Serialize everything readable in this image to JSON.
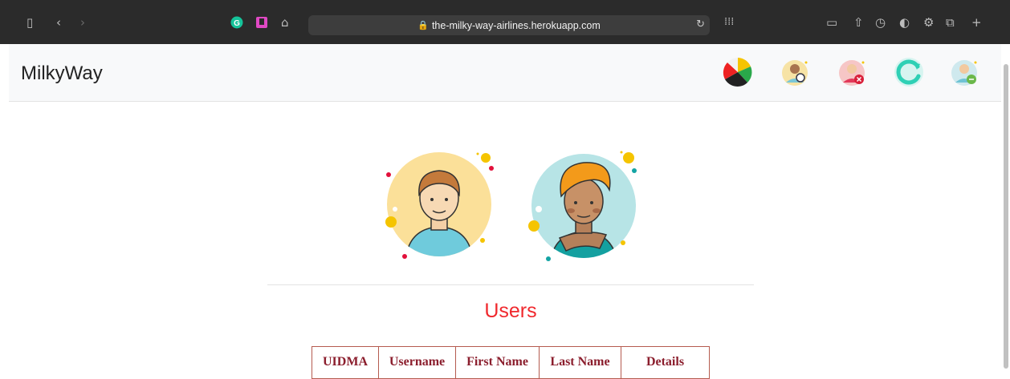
{
  "browser": {
    "url": "the-milky-way-airlines.herokuapp.com"
  },
  "navbar": {
    "brand": "MilkyWay"
  },
  "page": {
    "heading": "Users",
    "table": {
      "columns": [
        "UIDMA",
        "Username",
        "First Name",
        "Last Name",
        "Details"
      ]
    }
  },
  "colors": {
    "heading": "#f0282d",
    "table_header_text": "#8b1e2d",
    "table_border": "#b55b4f"
  }
}
